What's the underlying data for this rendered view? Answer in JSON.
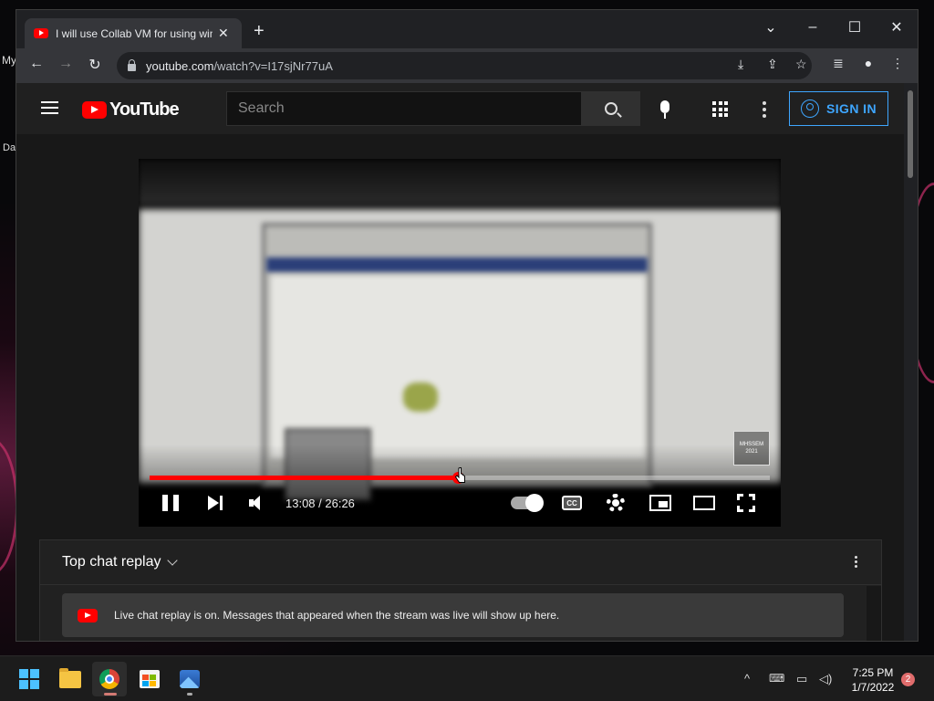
{
  "desktop": {
    "labels": [
      "My",
      "Da"
    ]
  },
  "window": {
    "tab": {
      "title": "I will use Collab VM for using windows",
      "close": "✕"
    },
    "new_tab": "+",
    "controls": {
      "tab_search": "⌄",
      "minimize": "–",
      "maximize": "☐",
      "close": "✕"
    }
  },
  "toolbar": {
    "back": "←",
    "forward": "→",
    "reload": "↻",
    "url_host": "youtube.com",
    "url_path": "/watch?v=I17sjNr77uA",
    "icons": [
      "install-icon",
      "share-icon",
      "bookmark-star-icon",
      "reading-list-icon",
      "profile-icon",
      "menu-icon"
    ]
  },
  "youtube": {
    "logo": "YouTube",
    "search_placeholder": "Search",
    "sign_in": "SIGN IN",
    "accent": "#3ea6ff",
    "brand": "#ff0000"
  },
  "player": {
    "current_time": "13:08",
    "total_time": "26:26",
    "time_display": "13:08 / 26:26",
    "progress_fraction": 0.4967,
    "watermark": "MHSSEM\n2021",
    "cc_label": "CC"
  },
  "chat": {
    "title": "Top chat replay",
    "message": "Live chat replay is on. Messages that appeared when the stream was live will show up here."
  },
  "taskbar": {
    "apps": [
      "start-icon",
      "file-explorer-icon",
      "chrome-icon",
      "store-icon",
      "photos-icon"
    ],
    "tray_chevron": "^",
    "time": "7:25 PM",
    "date": "1/7/2022",
    "notifications": "2"
  }
}
